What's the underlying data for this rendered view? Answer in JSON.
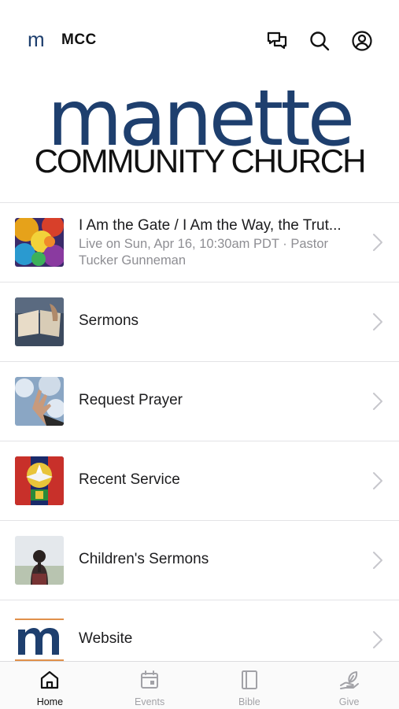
{
  "header": {
    "logo": "m",
    "title": "MCC",
    "icons": [
      "chat-icon",
      "search-icon",
      "profile-icon"
    ]
  },
  "brand": {
    "name": "manette",
    "subtitle": "COMMUNITY CHURCH"
  },
  "list": [
    {
      "title": "I Am the Gate / I Am the Way, the Trut...",
      "subtitle": "Live on Sun, Apr 16, 10:30am PDT · Pastor Tucker Gunneman",
      "thumb": "abstract-painting"
    },
    {
      "title": "Sermons",
      "thumb": "open-bible"
    },
    {
      "title": "Request Prayer",
      "thumb": "raised-hand"
    },
    {
      "title": "Recent Service",
      "thumb": "stained-glass"
    },
    {
      "title": "Children's Sermons",
      "thumb": "child-outdoors"
    },
    {
      "title": "Website",
      "thumb": "m-logo"
    }
  ],
  "tabs": [
    {
      "label": "Home",
      "icon": "home-icon",
      "active": true
    },
    {
      "label": "Events",
      "icon": "calendar-icon",
      "active": false
    },
    {
      "label": "Bible",
      "icon": "book-icon",
      "active": false
    },
    {
      "label": "Give",
      "icon": "leaf-hand-icon",
      "active": false
    }
  ],
  "colors": {
    "brand_blue": "#1e3f6e",
    "secondary_text": "#8e8e93",
    "tab_inactive": "#a2a2a7"
  }
}
